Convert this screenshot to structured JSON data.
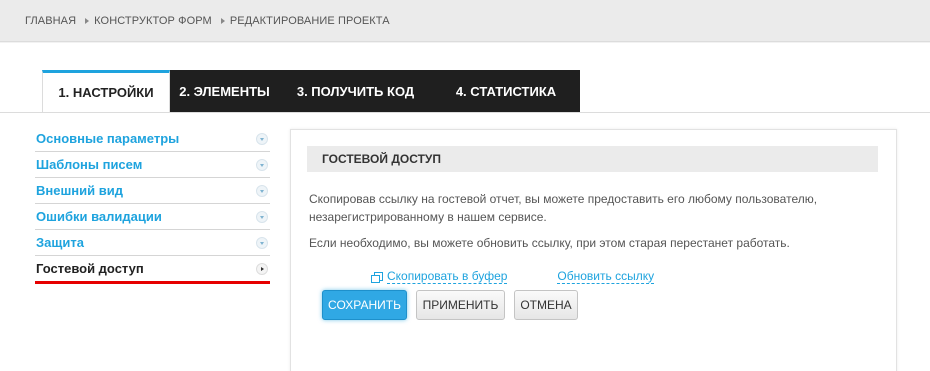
{
  "breadcrumbs": [
    "ГЛАВНАЯ",
    "КОНСТРУКТОР ФОРМ",
    "РЕДАКТИРОВАНИЕ ПРОЕКТА"
  ],
  "tabs": [
    {
      "label": "1. НАСТРОЙКИ",
      "active": true
    },
    {
      "label": "2. ЭЛЕМЕНТЫ",
      "active": false
    },
    {
      "label": "3. ПОЛУЧИТЬ КОД",
      "active": false
    },
    {
      "label": "4. СТАТИСТИКА",
      "active": false
    }
  ],
  "sidebar": {
    "items": [
      {
        "label": "Основные параметры"
      },
      {
        "label": "Шаблоны писем"
      },
      {
        "label": "Внешний вид"
      },
      {
        "label": "Ошибки валидации"
      },
      {
        "label": "Защита"
      },
      {
        "label": "Гостевой доступ",
        "active": true
      }
    ]
  },
  "panel": {
    "title": "ГОСТЕВОЙ ДОСТУП",
    "text1": "Скопировав ссылку на гостевой отчет, вы можете предоставить его любому пользователю, незарегистрированному в нашем сервисе.",
    "text2": "Если необходимо, вы можете обновить ссылку, при этом старая перестанет работать.",
    "copy_link": "Скопировать в буфер",
    "refresh_link": "Обновить ссылку"
  },
  "buttons": {
    "save": "СОХРАНИТЬ",
    "apply": "ПРИМЕНИТЬ",
    "cancel": "ОТМЕНА"
  },
  "colors": {
    "accent": "#1ea3de",
    "tab_dark": "#1f1f1f",
    "highlight_underline": "#e60000"
  }
}
